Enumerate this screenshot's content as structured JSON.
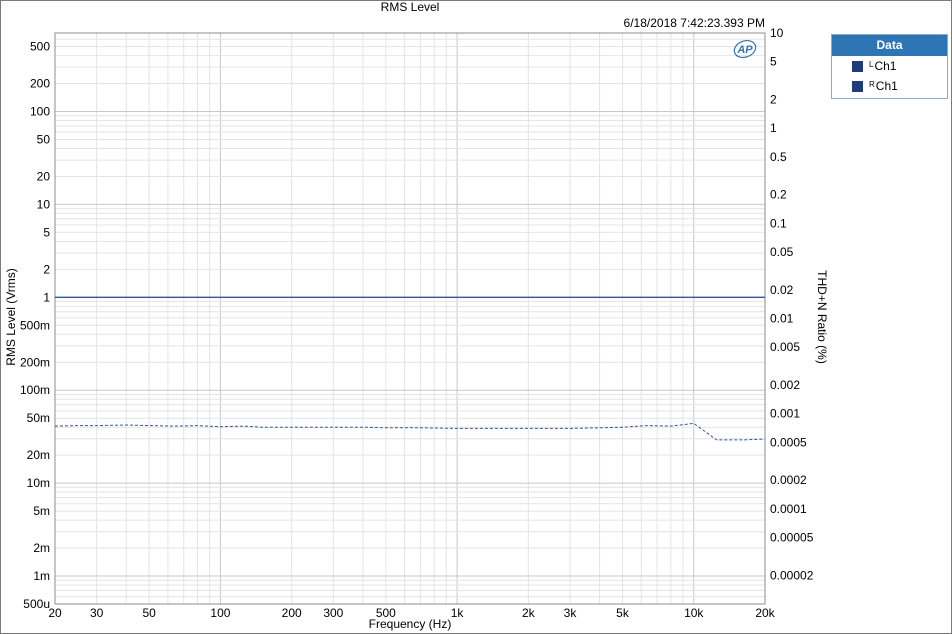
{
  "chart_data": {
    "type": "line",
    "title": "RMS Level",
    "timestamp": "6/18/2018 7:42:23.393 PM",
    "xlabel": "Frequency (Hz)",
    "ylabel": "RMS Level (Vrms)",
    "y2label": "THD+N Ratio (%)",
    "x_scale": "log",
    "y_scale": "log",
    "y2_scale": "log",
    "xlim": [
      20,
      20000
    ],
    "ylim": [
      0.0005,
      700
    ],
    "y2lim": [
      1e-05,
      10
    ],
    "x_ticks": [
      {
        "v": 20,
        "label": "20"
      },
      {
        "v": 30,
        "label": "30"
      },
      {
        "v": 50,
        "label": "50"
      },
      {
        "v": 100,
        "label": "100"
      },
      {
        "v": 200,
        "label": "200"
      },
      {
        "v": 300,
        "label": "300"
      },
      {
        "v": 500,
        "label": "500"
      },
      {
        "v": 1000,
        "label": "1k"
      },
      {
        "v": 2000,
        "label": "2k"
      },
      {
        "v": 3000,
        "label": "3k"
      },
      {
        "v": 5000,
        "label": "5k"
      },
      {
        "v": 10000,
        "label": "10k"
      },
      {
        "v": 20000,
        "label": "20k"
      }
    ],
    "y_ticks": [
      {
        "v": 500,
        "label": "500"
      },
      {
        "v": 200,
        "label": "200"
      },
      {
        "v": 100,
        "label": "100"
      },
      {
        "v": 50,
        "label": "50"
      },
      {
        "v": 20,
        "label": "20"
      },
      {
        "v": 10,
        "label": "10"
      },
      {
        "v": 5,
        "label": "5"
      },
      {
        "v": 2,
        "label": "2"
      },
      {
        "v": 1,
        "label": "1"
      },
      {
        "v": 0.5,
        "label": "500m"
      },
      {
        "v": 0.2,
        "label": "200m"
      },
      {
        "v": 0.1,
        "label": "100m"
      },
      {
        "v": 0.05,
        "label": "50m"
      },
      {
        "v": 0.02,
        "label": "20m"
      },
      {
        "v": 0.01,
        "label": "10m"
      },
      {
        "v": 0.005,
        "label": "5m"
      },
      {
        "v": 0.002,
        "label": "2m"
      },
      {
        "v": 0.001,
        "label": "1m"
      },
      {
        "v": 0.0005,
        "label": "500u"
      }
    ],
    "y2_ticks": [
      {
        "v": 10,
        "label": "10"
      },
      {
        "v": 5,
        "label": "5"
      },
      {
        "v": 2,
        "label": "2"
      },
      {
        "v": 1,
        "label": "1"
      },
      {
        "v": 0.5,
        "label": "0.5"
      },
      {
        "v": 0.2,
        "label": "0.2"
      },
      {
        "v": 0.1,
        "label": "0.1"
      },
      {
        "v": 0.05,
        "label": "0.05"
      },
      {
        "v": 0.02,
        "label": "0.02"
      },
      {
        "v": 0.01,
        "label": "0.01"
      },
      {
        "v": 0.005,
        "label": "0.005"
      },
      {
        "v": 0.002,
        "label": "0.002"
      },
      {
        "v": 0.001,
        "label": "0.001"
      },
      {
        "v": 0.0005,
        "label": "0.0005"
      },
      {
        "v": 0.0002,
        "label": "0.0002"
      },
      {
        "v": 0.0001,
        "label": "0.0001"
      },
      {
        "v": 5e-05,
        "label": "0.00005"
      },
      {
        "v": 2e-05,
        "label": "0.00002"
      }
    ],
    "grid": true,
    "series": [
      {
        "axis": "left",
        "style": "solid",
        "color": "#2e5a9a",
        "x": [
          20,
          20000
        ],
        "values": [
          1.0,
          1.0
        ]
      },
      {
        "axis": "right",
        "style": "dashed",
        "color": "#2e5a9a",
        "x": [
          20,
          25,
          30,
          40,
          50,
          65,
          80,
          100,
          125,
          150,
          200,
          300,
          400,
          500,
          700,
          1000,
          1500,
          2000,
          3000,
          4000,
          5000,
          6300,
          8000,
          10000,
          12500,
          16000,
          20000
        ],
        "values": [
          0.00074,
          0.00075,
          0.00075,
          0.00076,
          0.00075,
          0.00074,
          0.00075,
          0.00073,
          0.00074,
          0.00072,
          0.00072,
          0.00072,
          0.00072,
          0.00071,
          0.00071,
          0.0007,
          0.0007,
          0.0007,
          0.0007,
          0.00071,
          0.00072,
          0.00075,
          0.00074,
          0.00079,
          0.00053,
          0.00053,
          0.00054
        ]
      }
    ],
    "legend": {
      "title": "Data",
      "position": "top-right",
      "entries": [
        {
          "sup": "L",
          "label": "Ch1",
          "color": "#1f3c7a"
        },
        {
          "sup": "R",
          "label": "Ch1",
          "color": "#1f3c7a"
        }
      ]
    }
  },
  "logo": {
    "name": "ap-logo",
    "text": "AP",
    "color": "#2e75b6"
  }
}
